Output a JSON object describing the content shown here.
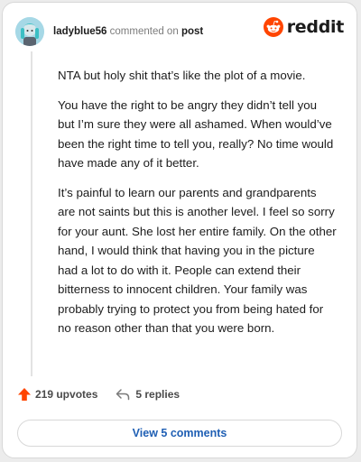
{
  "header": {
    "username": "ladyblue56",
    "commented_on": "commented on",
    "post_link": "post",
    "logo_text": "reddit"
  },
  "comment": {
    "paragraphs": [
      "NTA but holy shit that’s like the plot of a movie.",
      "You have the right to be angry they didn’t tell you but I’m sure they were all ashamed. When would’ve been the right time to tell you, really? No time would have made any of it better.",
      "It’s painful to learn our parents and grandparents are not saints but this is another level. I feel so sorry for your aunt. She lost her entire family. On the other hand, I would think that having you in the picture had a lot to do with it. People can extend their bitterness to innocent children. Your family was probably trying to protect you from being hated for no reason other than that you were born."
    ]
  },
  "footer": {
    "upvotes": "219 upvotes",
    "replies": "5 replies",
    "view_comments": "View 5 comments"
  },
  "colors": {
    "reddit_orange": "#ff4500",
    "link_blue": "#1f5fb4"
  },
  "icons": {
    "upvote": "upvote-arrow-icon",
    "reply": "reply-arrow-icon",
    "logo": "reddit-snoo-icon",
    "avatar": "user-avatar"
  }
}
